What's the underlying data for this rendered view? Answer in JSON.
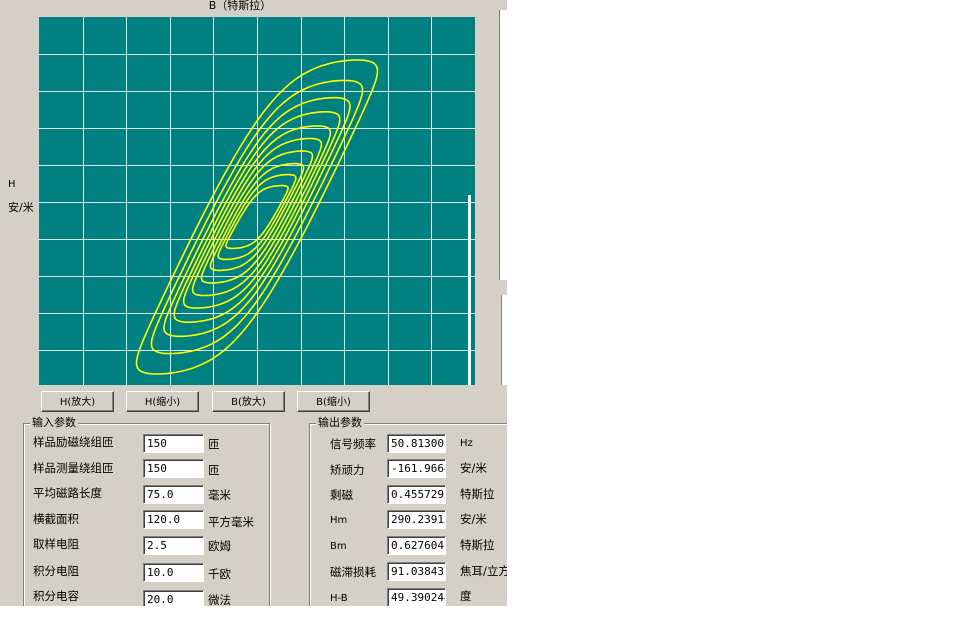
{
  "chart": {
    "title": "B（特斯拉）",
    "y_label_symbol": "H",
    "y_label_unit": "安/米"
  },
  "buttons": {
    "h_zoom_in": "H(放大)",
    "h_zoom_out": "H(缩小)",
    "b_zoom_in": "B(放大)",
    "b_zoom_out": "B(缩小)"
  },
  "input_params": {
    "title": "输入参数",
    "rows": [
      {
        "label": "样品励磁绕组匝",
        "value": "150",
        "unit": "匝"
      },
      {
        "label": "样品测量绕组匝",
        "value": "150",
        "unit": "匝"
      },
      {
        "label": "平均磁路长度",
        "value": "75.0",
        "unit": "毫米"
      },
      {
        "label": "横截面积",
        "value": "120.0",
        "unit": "平方毫米"
      },
      {
        "label": "取样电阻",
        "value": "2.5",
        "unit": "欧姆"
      },
      {
        "label": "积分电阻",
        "value": "10.0",
        "unit": "千欧"
      },
      {
        "label": "积分电容",
        "value": "20.0",
        "unit": "微法"
      }
    ]
  },
  "output_params": {
    "title": "输出参数",
    "rows": [
      {
        "label": "信号频率",
        "value": "50.813008",
        "unit": "Hz"
      },
      {
        "label": "矫顽力",
        "value": "-161.9664",
        "unit": "安/米"
      },
      {
        "label": "剩磁",
        "value": "0.455729",
        "unit": "特斯拉"
      },
      {
        "label": "Hm",
        "value": "290.23912",
        "unit": "安/米"
      },
      {
        "label": "Bm",
        "value": "0.627604",
        "unit": "特斯拉"
      },
      {
        "label": "磁滞损耗",
        "value": "91.038437",
        "unit": "焦耳/立方"
      },
      {
        "label": "H-B",
        "value": "49.390244",
        "unit": "度"
      }
    ]
  },
  "chart_data": {
    "type": "line",
    "title": "B（特斯拉）",
    "xlabel": "",
    "ylabel": "H 安/米",
    "grid": true,
    "background": "#008080",
    "grid_color": "#ffffff",
    "trace_color": "#ffff00",
    "grid_divisions": {
      "x": 10,
      "y": 10
    },
    "loops": [
      {
        "amplitude_x": 1.0,
        "amplitude_y": 1.0
      },
      {
        "amplitude_x": 0.88,
        "amplitude_y": 0.87
      },
      {
        "amplitude_x": 0.78,
        "amplitude_y": 0.76
      },
      {
        "amplitude_x": 0.7,
        "amplitude_y": 0.67
      },
      {
        "amplitude_x": 0.63,
        "amplitude_y": 0.58
      },
      {
        "amplitude_x": 0.56,
        "amplitude_y": 0.5
      },
      {
        "amplitude_x": 0.49,
        "amplitude_y": 0.42
      },
      {
        "amplitude_x": 0.42,
        "amplitude_y": 0.34
      },
      {
        "amplitude_x": 0.36,
        "amplitude_y": 0.27
      },
      {
        "amplitude_x": 0.3,
        "amplitude_y": 0.2
      }
    ]
  }
}
